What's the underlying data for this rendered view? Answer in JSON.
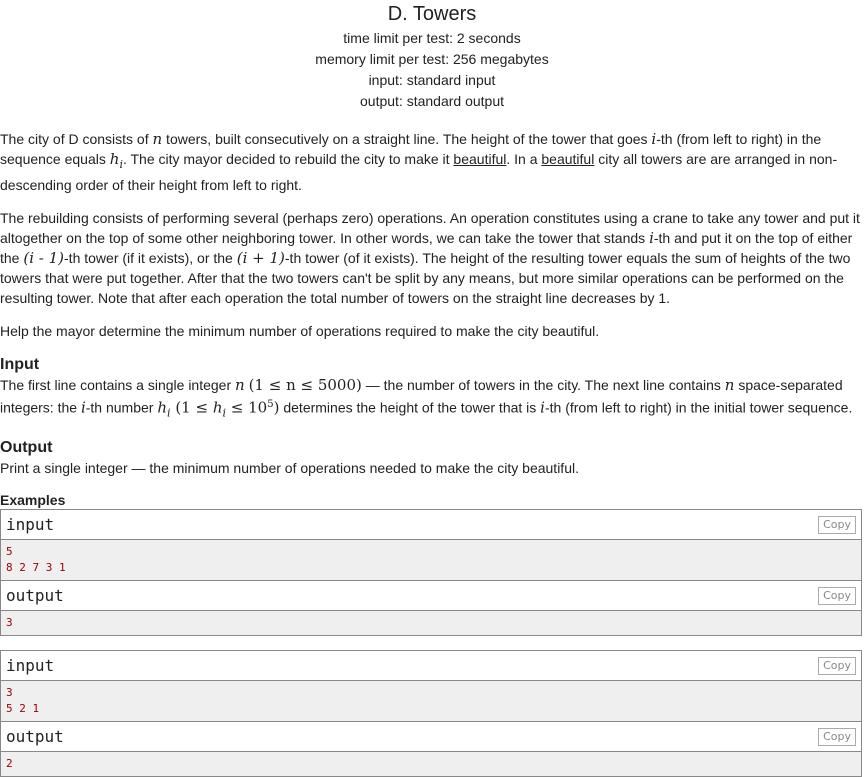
{
  "problem": {
    "title": "D. Towers",
    "time_limit": "time limit per test: 2 seconds",
    "memory_limit": "memory limit per test: 256 megabytes",
    "input_file": "input: standard input",
    "output_file": "output: standard output"
  },
  "statement": {
    "p1": {
      "a": "The city of D consists of ",
      "n": "n",
      "b": " towers, built consecutively on a straight line. The height of the tower that goes ",
      "i": "i",
      "c": "-th (from left to right) in the sequence equals ",
      "h": "h",
      "hsub": "i",
      "d": ". The city mayor decided to rebuild the city to make it ",
      "beautiful1": "beautiful",
      "e": ". In a ",
      "beautiful2": "beautiful",
      "f": " city all towers are are arranged in non-descending order of their height from left to right."
    },
    "p2": {
      "a": "The rebuilding consists of performing several (perhaps zero) operations. An operation constitutes using a crane to take any tower and put it altogether on the top of some other neighboring tower. In other words, we can take the tower that stands ",
      "i": "i",
      "b": "-th and put it on the top of either the ",
      "m1": "(i - 1)",
      "c": "-th tower (if it exists), or the ",
      "m2": "(i + 1)",
      "d": "-th tower (of it exists). The height of the resulting tower equals the sum of heights of the two towers that were put together. After that the two towers can't be split by any means, but more similar operations can be performed on the resulting tower. Note that after each operation the total number of towers on the straight line decreases by 1."
    },
    "p3": "Help the mayor determine the minimum number of operations required to make the city beautiful."
  },
  "input_section": {
    "title": "Input",
    "a": "The first line contains a single integer ",
    "n": "n",
    "m1": "(1 ≤ n ≤ 5000)",
    "b": " — the number of towers in the city. The next line contains ",
    "n2": "n",
    "c": " space-separated integers: the ",
    "i": "i",
    "d": "-th number ",
    "h": "h",
    "hsub": "i",
    "m2a": " (1 ≤ ",
    "m2h": "h",
    "m2sub": "i",
    "m2b": " ≤ 10",
    "m2sup": "5",
    "m2c": ")",
    "e": " determines the height of the tower that is ",
    "i2": "i",
    "f": "-th (from left to right) in the initial tower sequence."
  },
  "output_section": {
    "title": "Output",
    "text": "Print a single integer — the minimum number of operations needed to make the city beautiful."
  },
  "examples": {
    "title": "Examples",
    "input_label": "input",
    "output_label": "output",
    "copy_label": "Copy",
    "items": [
      {
        "input": "5\n8 2 7 3 1",
        "output": "3"
      },
      {
        "input": "3\n5 2 1",
        "output": "2"
      }
    ]
  }
}
